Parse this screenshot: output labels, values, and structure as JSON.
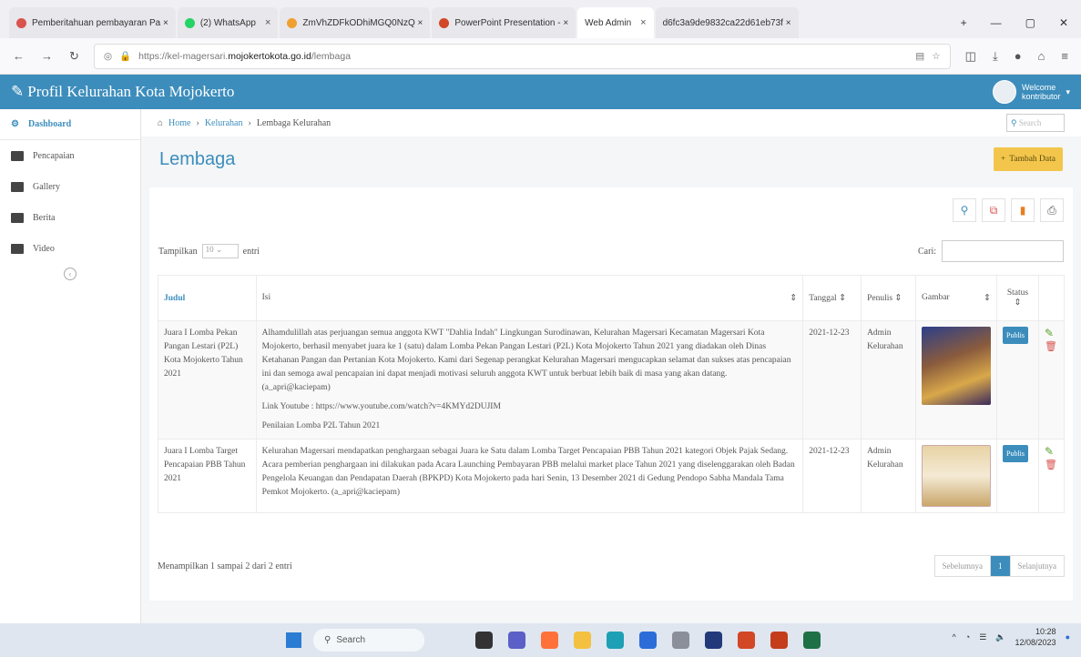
{
  "browser": {
    "tabs": [
      {
        "label": "Pemberitahuan pembayaran Pa ×",
        "color": "#d9534f"
      },
      {
        "label": "(2) WhatsApp",
        "color": "#25d366"
      },
      {
        "label": "ZmVhZDFkODhiMGQ0NzQ ×",
        "color": "#f0a030"
      },
      {
        "label": "PowerPoint Presentation - ×",
        "color": "#d24726"
      },
      {
        "label": "Web Admin",
        "color": "#ffffff"
      },
      {
        "label": "d6fc3a9de9832ca22d61eb73f ×",
        "color": "#cccccc"
      }
    ],
    "url_prefix": "https://kel-magersari.",
    "url_domain": "mojokertokota.go.id",
    "url_path": "/lembaga"
  },
  "app": {
    "brand": "Profil Kelurahan Kota Mojokerto",
    "welcome": "Welcome",
    "user": "kontributor"
  },
  "sidebar": {
    "items": [
      {
        "label": "Dashboard"
      },
      {
        "label": "Pencapaian"
      },
      {
        "label": "Gallery"
      },
      {
        "label": "Berita"
      },
      {
        "label": "Video"
      }
    ]
  },
  "breadcrumb": {
    "home": "Home",
    "parent": "Kelurahan",
    "current": "Lembaga Kelurahan",
    "search_placeholder": "Search"
  },
  "page": {
    "title": "Lembaga",
    "add_label": "Tambah Data"
  },
  "table": {
    "show_label": "Tampilkan",
    "show_value": "10",
    "entries_label": "entri",
    "search_label": "Cari:",
    "headers": [
      "Judul",
      "Isi",
      "Tanggal",
      "Penulis",
      "Gambar",
      "Status"
    ],
    "rows": [
      {
        "judul": "Juara I Lomba Pekan Pangan Lestari (P2L) Kota Mojokerto Tahun 2021",
        "isi_1": "Alhamdulillah atas perjuangan semua anggota KWT \"Dahlia Indah\" Lingkungan Surodinawan, Kelurahan Magersari Kecamatan Magersari Kota Mojokerto, berhasil menyabet juara ke 1 (satu) dalam Lomba Pekan Pangan Lestari (P2L) Kota Mojokerto Tahun 2021 yang diadakan oleh Dinas Ketahanan Pangan dan Pertanian Kota Mojokerto. Kami dari Segenap perangkat Kelurahan Magersari mengucapkan selamat dan sukses atas pencapaian ini dan semoga awal pencapaian ini dapat menjadi motivasi seluruh anggota KWT untuk berbuat lebih baik di masa yang akan datang. (a_apri@kaciepam)",
        "isi_2": "Link Youtube : https://www.youtube.com/watch?v=4KMYd2DUJIM",
        "isi_3": "Penilaian Lomba P2L Tahun 2021",
        "tanggal": "2021-12-23",
        "penulis": "Admin Kelurahan",
        "status": "Publis"
      },
      {
        "judul": "Juara I Lomba Target Pencapaian PBB Tahun 2021",
        "isi_1": "Kelurahan Magersari mendapatkan penghargaan sebagai Juara ke Satu dalam Lomba Target Pencapaian PBB Tahun 2021 kategori Objek Pajak Sedang. Acara pemberian penghargaan ini dilakukan pada Acara Launching Pembayaran PBB melalui market place Tahun 2021 yang diselenggarakan oleh Badan Pengelola Keuangan dan Pendapatan Daerah (BPKPD) Kota Mojokerto pada hari Senin, 13 Desember 2021 di Gedung Pendopo Sabha Mandala Tama Pemkot Mojokerto. (a_apri@kaciepam)",
        "tanggal": "2021-12-23",
        "penulis": "Admin Kelurahan",
        "status": "Publis"
      }
    ],
    "info": "Menampilkan 1 sampai 2 dari 2 entri",
    "prev": "Sebelumnya",
    "page": "1",
    "next": "Selanjutnya"
  },
  "taskbar": {
    "search": "Search",
    "time": "10:28",
    "date": "12/08/2023"
  }
}
